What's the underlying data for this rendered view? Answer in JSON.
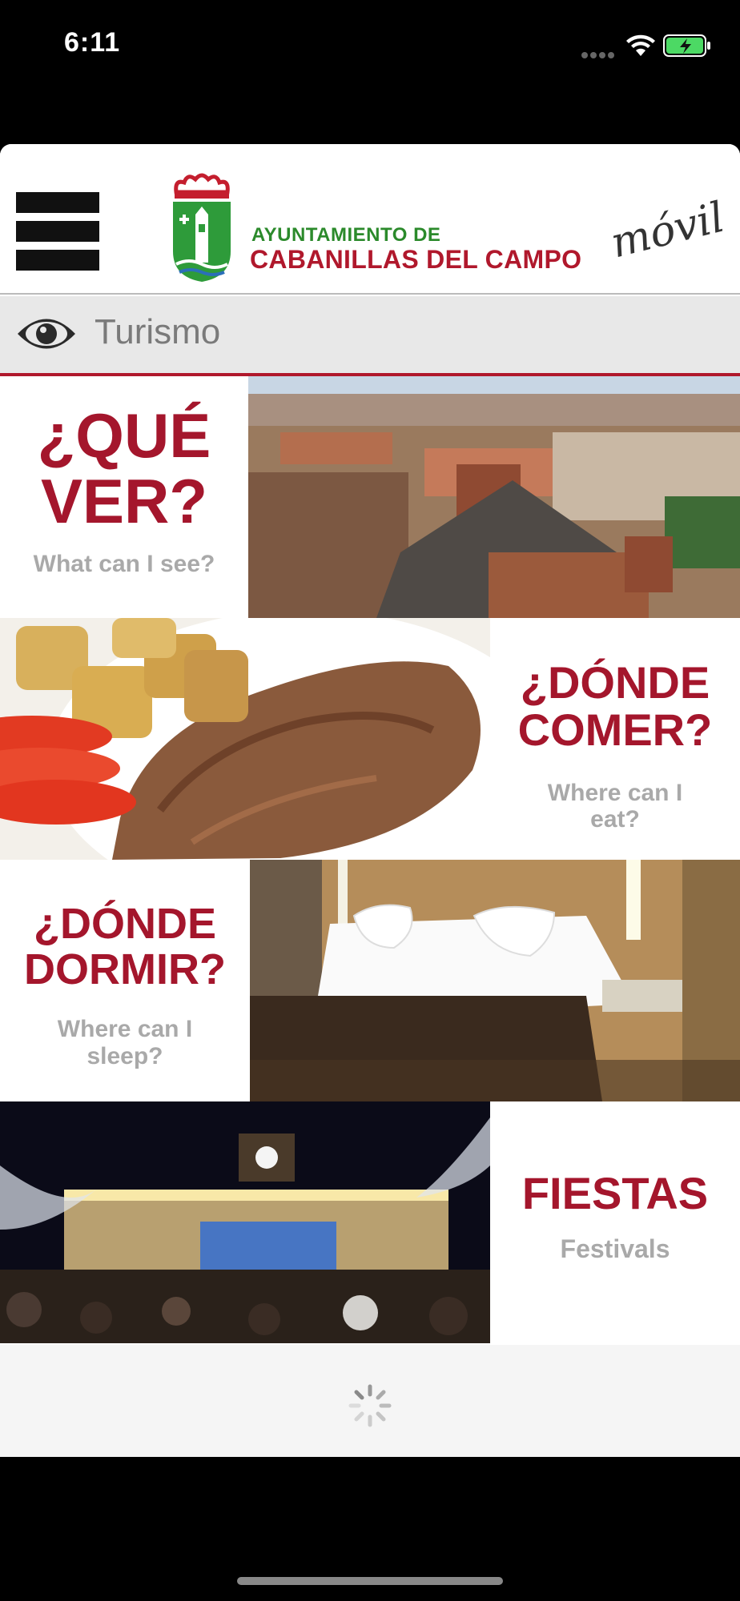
{
  "status_bar": {
    "time": "6:11"
  },
  "header": {
    "title_small": "AYUNTAMIENTO DE",
    "title_large": "CABANILLAS DEL CAMPO",
    "movil": "móvil"
  },
  "section": {
    "title": "Turismo"
  },
  "tiles": [
    {
      "title": "¿QUÉ VER?",
      "subtitle": "What can I see?"
    },
    {
      "title": "¿DÓNDE COMER?",
      "subtitle": "Where can I eat?"
    },
    {
      "title": "¿DÓNDE DORMIR?",
      "subtitle": "Where can I sleep?"
    },
    {
      "title": "FIESTAS",
      "subtitle": "Festivals"
    }
  ],
  "colors": {
    "accent": "#a4162c",
    "green": "#2b8a2b",
    "subtitle": "#a9a9a9"
  }
}
